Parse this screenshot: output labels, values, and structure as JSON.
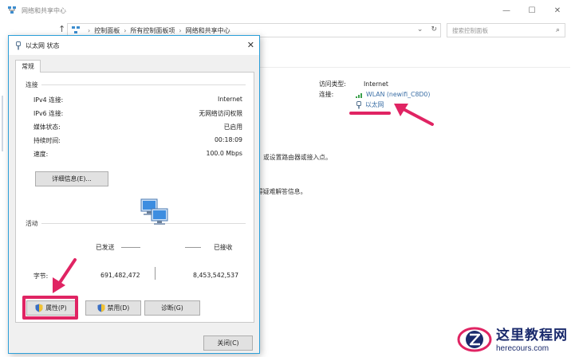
{
  "background_window": {
    "title": "网络和共享中心",
    "controls": {
      "minimize": "—",
      "maximize": "☐",
      "close": "✕"
    },
    "nav": {
      "back": "←",
      "forward": "→",
      "up": "↑",
      "refresh": "↻",
      "dropdown": "⌄"
    },
    "breadcrumb": [
      "控制面板",
      "所有控制面板项",
      "网络和共享中心"
    ],
    "breadcrumb_sep": "›",
    "search_placeholder": "搜索控制面板",
    "network_info": {
      "access_type_label": "访问类型:",
      "access_type_value": "Internet",
      "connections_label": "连接:",
      "wlan_link": "WLAN (newifi_C8D0)",
      "ethernet_link": "以太网"
    },
    "text_snippet_1": "或设置路由器或接入点。",
    "text_snippet_2": "得疑难解答信息。"
  },
  "dialog": {
    "title": "以太网 状态",
    "close": "✕",
    "tab": "常规",
    "connection": {
      "label": "连接",
      "rows": [
        {
          "key": "IPv4 连接:",
          "value": "Internet"
        },
        {
          "key": "IPv6 连接:",
          "value": "无网络访问权限"
        },
        {
          "key": "媒体状态:",
          "value": "已启用"
        },
        {
          "key": "持续时间:",
          "value": "00:18:09"
        },
        {
          "key": "速度:",
          "value": "100.0 Mbps"
        }
      ],
      "details_button": "详细信息(E)..."
    },
    "activity": {
      "label": "活动",
      "sent_label": "已发送",
      "received_label": "已接收",
      "bytes_label": "字节:",
      "bytes_sent": "691,482,472",
      "bytes_received": "8,453,542,537"
    },
    "buttons": {
      "properties": "属性(P)",
      "disable": "禁用(D)",
      "diagnose": "诊断(G)",
      "close": "关闭(C)"
    }
  },
  "watermark": {
    "cn": "这里教程网",
    "en": "herecours.com"
  },
  "colors": {
    "accent_highlight": "#e02463",
    "dialog_border": "#2b9fd9",
    "link": "#3a6ea5"
  }
}
